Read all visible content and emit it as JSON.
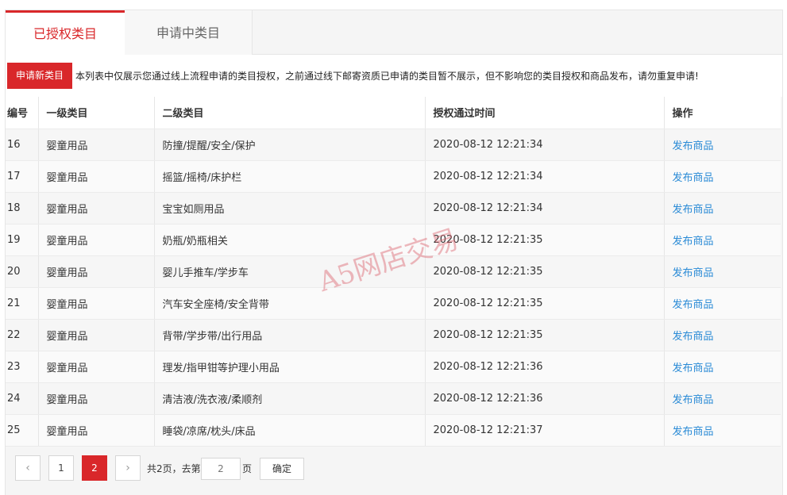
{
  "tabs": [
    {
      "label": "已授权类目",
      "active": true
    },
    {
      "label": "申请中类目",
      "active": false
    }
  ],
  "actions": {
    "apply_button": "申请新类目",
    "notice": "本列表中仅展示您通过线上流程申请的类目授权，之前通过线下邮寄资质已申请的类目暂不展示，但不影响您的类目授权和商品发布，请勿重复申请!"
  },
  "table": {
    "headers": [
      "编号",
      "一级类目",
      "二级类目",
      "授权通过时间",
      "操作"
    ],
    "rows": [
      {
        "id": "16",
        "level1": "婴童用品",
        "level2": "防撞/提醒/安全/保护",
        "time": "2020-08-12 12:21:34",
        "action": "发布商品"
      },
      {
        "id": "17",
        "level1": "婴童用品",
        "level2": "摇篮/摇椅/床护栏",
        "time": "2020-08-12 12:21:34",
        "action": "发布商品"
      },
      {
        "id": "18",
        "level1": "婴童用品",
        "level2": "宝宝如厕用品",
        "time": "2020-08-12 12:21:34",
        "action": "发布商品"
      },
      {
        "id": "19",
        "level1": "婴童用品",
        "level2": "奶瓶/奶瓶相关",
        "time": "2020-08-12 12:21:35",
        "action": "发布商品"
      },
      {
        "id": "20",
        "level1": "婴童用品",
        "level2": "婴儿手推车/学步车",
        "time": "2020-08-12 12:21:35",
        "action": "发布商品"
      },
      {
        "id": "21",
        "level1": "婴童用品",
        "level2": "汽车安全座椅/安全背带",
        "time": "2020-08-12 12:21:35",
        "action": "发布商品"
      },
      {
        "id": "22",
        "level1": "婴童用品",
        "level2": "背带/学步带/出行用品",
        "time": "2020-08-12 12:21:35",
        "action": "发布商品"
      },
      {
        "id": "23",
        "level1": "婴童用品",
        "level2": "理发/指甲钳等护理小用品",
        "time": "2020-08-12 12:21:36",
        "action": "发布商品"
      },
      {
        "id": "24",
        "level1": "婴童用品",
        "level2": "清洁液/洗衣液/柔顺剂",
        "time": "2020-08-12 12:21:36",
        "action": "发布商品"
      },
      {
        "id": "25",
        "level1": "婴童用品",
        "level2": "睡袋/凉席/枕头/床品",
        "time": "2020-08-12 12:21:37",
        "action": "发布商品"
      }
    ]
  },
  "watermark": "A5网店交易",
  "pagination": {
    "prev_icon": "‹",
    "next_icon": "›",
    "pages": [
      "1",
      "2"
    ],
    "current": "2",
    "total_text": "共2页，去第",
    "goto_value": "2",
    "page_suffix": "页",
    "confirm_label": "确定"
  },
  "colors": {
    "accent": "#d9272a",
    "link": "#2b8bd6"
  }
}
